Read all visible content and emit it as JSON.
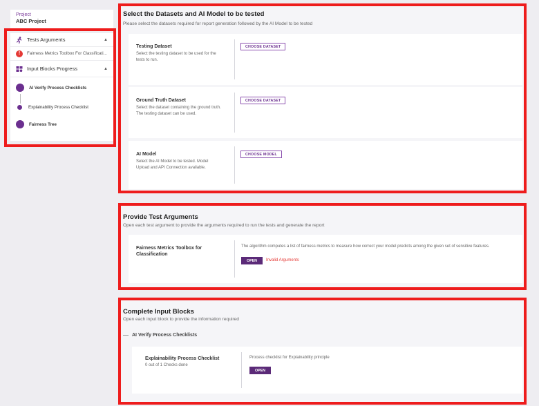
{
  "project": {
    "label": "Project",
    "name": "ABC Project"
  },
  "sidebar": {
    "tests_arguments": {
      "title": "Tests Arguments",
      "items": [
        {
          "label": "Fairness Metrics Toolbox For Classificati...",
          "status": "error"
        }
      ]
    },
    "input_blocks": {
      "title": "Input Blocks Progress",
      "steps": [
        {
          "label": "AI Verify Process Checklists"
        },
        {
          "label": "Explainability Process Checklist"
        },
        {
          "label": "Fairness Tree"
        }
      ]
    }
  },
  "datasets_section": {
    "title": "Select the Datasets and AI Model to be tested",
    "subtitle": "Please select the datasets required for report generation followed by the AI Model to be tested",
    "cards": [
      {
        "title": "Testing Dataset",
        "description": "Select the testing dataset to be used for the tests to run.",
        "button": "CHOOSE DATASET"
      },
      {
        "title": "Ground Truth Dataset",
        "description": "Select the dataset containing the ground truth. The testing dataset can be used.",
        "button": "CHOOSE DATASET"
      },
      {
        "title": "AI Model",
        "description": "Select the AI Model to be tested. Model Upload and API Connection available.",
        "button": "CHOOSE MODEL"
      }
    ]
  },
  "test_args_section": {
    "title": "Provide Test Arguments",
    "subtitle": "Open each test argument to provide the arguments required to run the tests and generate the report",
    "card": {
      "title": "Fairness Metrics Toolbox for Classification",
      "description": "The algorithm computes a list of fairness metrics to measure how correct your model predicts among the given set of sensitive features.",
      "button": "OPEN",
      "status": "Invalid Arguments"
    }
  },
  "input_blocks_section": {
    "title": "Complete Input Blocks",
    "subtitle": "Open each input block to provide the information required",
    "group": "AI Verify Process Checklists",
    "card": {
      "title": "Explainability Process Checklist",
      "progress": "0 out of 1 Checks done",
      "description": "Process checklist for Explainability principle",
      "button": "OPEN"
    }
  },
  "colors": {
    "accent": "#6b2f8f",
    "highlight": "#ee1c1c",
    "error": "#e53935"
  }
}
